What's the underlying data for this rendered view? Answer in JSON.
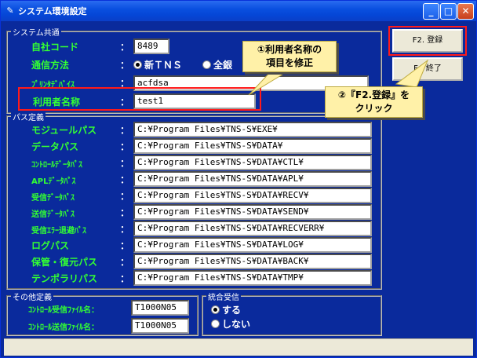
{
  "window": {
    "title": "システム環境設定",
    "title_icon": "app-icon"
  },
  "system_group": {
    "title": "システム共通",
    "company_code": {
      "label": "自社コード",
      "value": "8489"
    },
    "comm_method": {
      "label": "通信方法",
      "options": [
        {
          "label": "新ＴＮＳ",
          "selected": true
        },
        {
          "label": "全銀",
          "selected": false
        }
      ]
    },
    "printer_device": {
      "label": "ﾌﾟﾘﾝﾀﾃﾞﾊﾞｲｽ",
      "value": "acfdsa"
    },
    "user_name": {
      "label": "利用者名称",
      "value": "test1"
    }
  },
  "path_group": {
    "title": "パス定義",
    "rows": [
      {
        "label": "モジュールパス",
        "value": "C:¥Program Files¥TNS-S¥EXE¥"
      },
      {
        "label": "データパス",
        "value": "C:¥Program Files¥TNS-S¥DATA¥"
      },
      {
        "label": "ｺﾝﾄﾛｰﾙﾃﾞｰﾀﾊﾟｽ",
        "value": "C:¥Program Files¥TNS-S¥DATA¥CTL¥"
      },
      {
        "label": "APLﾃﾞｰﾀﾊﾟｽ",
        "value": "C:¥Program Files¥TNS-S¥DATA¥APL¥"
      },
      {
        "label": "受信ﾃﾞｰﾀﾊﾟｽ",
        "value": "C:¥Program Files¥TNS-S¥DATA¥RECV¥"
      },
      {
        "label": "送信ﾃﾞｰﾀﾊﾟｽ",
        "value": "C:¥Program Files¥TNS-S¥DATA¥SEND¥"
      },
      {
        "label": "受信ｴﾗｰ退避ﾊﾟｽ",
        "value": "C:¥Program Files¥TNS-S¥DATA¥RECVERR¥"
      },
      {
        "label": "ログパス",
        "value": "C:¥Program Files¥TNS-S¥DATA¥LOG¥"
      },
      {
        "label": "保管・復元パス",
        "value": "C:¥Program Files¥TNS-S¥DATA¥BACK¥"
      },
      {
        "label": "テンポラリパス",
        "value": "C:¥Program Files¥TNS-S¥DATA¥TMP¥"
      }
    ]
  },
  "other_group": {
    "title": "その他定義",
    "recv_file": {
      "label": "ｺﾝﾄﾛｰﾙ受信ﾌｧｲﾙ名：",
      "value": "T1000N05"
    },
    "send_file": {
      "label": "ｺﾝﾄﾛｰﾙ送信ﾌｧｲﾙ名：",
      "value": "T1000N05"
    }
  },
  "combined_group": {
    "title": "統合受信",
    "options": [
      {
        "label": "する",
        "selected": true
      },
      {
        "label": "しない",
        "selected": false
      }
    ]
  },
  "buttons": {
    "register": "F2. 登録",
    "exit": "F．終了"
  },
  "annotations": {
    "callout1_line1": "①利用者名称の",
    "callout1_line2": "項目を修正",
    "callout2_line1": "②『F2.登録』を",
    "callout2_line2": "クリック",
    "highlight_color": "#ff1a1a",
    "callout_color": "#fff1a8"
  },
  "colon": "："
}
